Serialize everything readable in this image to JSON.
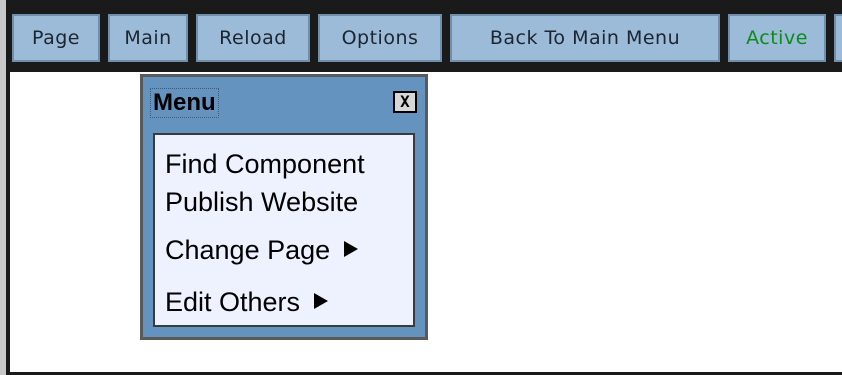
{
  "toolbar": {
    "items": [
      {
        "label": "Page"
      },
      {
        "label": "Main"
      },
      {
        "label": "Reload"
      },
      {
        "label": "Options"
      },
      {
        "label": "Back To Main Menu"
      },
      {
        "label": "Active",
        "color": "#0e8a1a"
      }
    ]
  },
  "menu": {
    "title": "Menu",
    "close_label": "X",
    "items": [
      {
        "label": "Find Component",
        "submenu": false
      },
      {
        "label": "Publish Website",
        "submenu": false
      },
      {
        "label": "Change Page",
        "submenu": true,
        "icon": "arrow-right-icon"
      },
      {
        "label": "Edit Others",
        "submenu": true,
        "icon": "arrow-right-icon"
      }
    ]
  },
  "colors": {
    "toolbar_button_bg": "#9bbbd8",
    "menu_window_bg": "#6493c0",
    "menu_body_bg": "#eef2ff",
    "active_text": "#0e8a1a"
  }
}
